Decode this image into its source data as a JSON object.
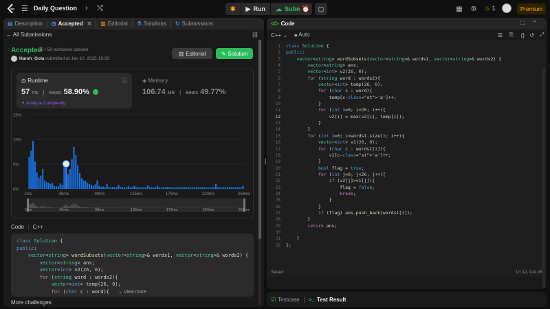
{
  "topbar": {
    "problem_title": "Daily Question",
    "run_label": "Run",
    "submit_label": "Submit",
    "streak": "1",
    "premium_label": "Premium"
  },
  "left_tabs": [
    {
      "label": "Description"
    },
    {
      "label": "Accepted"
    },
    {
      "label": "Editorial"
    },
    {
      "label": "Solutions"
    },
    {
      "label": "Submissions"
    }
  ],
  "submission": {
    "back_label": "All Submissions",
    "status": "Accepted",
    "passed": "56 / 56 testcases passed",
    "user": "Harsh_Gola",
    "submitted_text": "submitted at Jan 10, 2025 19:33",
    "editorial_button": "Editorial",
    "solution_button": "Solution"
  },
  "runtime": {
    "title": "Runtime",
    "value": "57",
    "unit": "ms",
    "beats_label": "Beats",
    "beats_pct": "58.90%",
    "analyze": "Analyze Complexity"
  },
  "memory": {
    "title": "Memory",
    "value": "106.74",
    "unit": "MB",
    "beats_label": "Beats",
    "beats_pct": "49.77%"
  },
  "chart_data": {
    "type": "bar",
    "ylabel": "",
    "ylim": [
      0,
      15
    ],
    "y_ticks": [
      "15%",
      "10%",
      "5%",
      "0%"
    ],
    "x_ticks": [
      "2ms",
      "46ms",
      "90ms",
      "135ms",
      "179ms",
      "224ms",
      "268ms"
    ],
    "x_range": [
      2,
      268
    ],
    "values": [
      6.5,
      7.7,
      9.7,
      5.5,
      3.3,
      2.2,
      2.7,
      4.0,
      1.7,
      1.4,
      1.2,
      1.0,
      1.2,
      0.6,
      0.5,
      0.5,
      1.1,
      0.8,
      4.5,
      5.6,
      3.0,
      4.0,
      6.0,
      8.5,
      6.8,
      4.8,
      3.2,
      2.2,
      1.7,
      1.6,
      1.2,
      1.0,
      0.8,
      0.6,
      0.9,
      1.7,
      0.6,
      0.4,
      0.5,
      0.3,
      1.0,
      0.4,
      0.3,
      0.4,
      0.3,
      0.3,
      0.8,
      0.4,
      0.3,
      0.3,
      0.3,
      0.6,
      0.3,
      0.3,
      0.6,
      0.3,
      0.3,
      0.3,
      0.3,
      0.3,
      0.3,
      0.7,
      0.3,
      0.3,
      0.3,
      0.3,
      0.6,
      0.3,
      0.3,
      0.3,
      0.3,
      0.4,
      0.3,
      0.3,
      0.3,
      0.3,
      0.3,
      0.3,
      0.3,
      0.3,
      0.3,
      0.3,
      0.3,
      0.3,
      0.3,
      0.3,
      0.3,
      0.3,
      0.3,
      0.3,
      0.3,
      0.3,
      0.3,
      0.3,
      0.3,
      0.3,
      1.0,
      0.3,
      0.3,
      0.3,
      0.3,
      0.3,
      0.3,
      0.4,
      0.3,
      0.3,
      0.3,
      0.3,
      0.3,
      0.3,
      0.6
    ],
    "highlight_index": 19,
    "mini_ticks": [
      "2ms",
      "46ms",
      "90ms",
      "135ms",
      "179ms",
      "224ms",
      "268ms"
    ]
  },
  "code_section": {
    "label": "Code",
    "language": "C++",
    "preview_lines": [
      "class Solution {",
      "public:",
      "    vector<string> wordSubsets(vector<string>& words1, vector<string>& words2) {",
      "        vector<string> ans;",
      "        vector<int> v2(26, 0);",
      "        for (string word : words2){",
      "            vector<int> temp(26, 0);",
      "            for (char c : word){"
    ],
    "view_more": "View more",
    "more_challenges": "More challenges"
  },
  "editor": {
    "panel_title": "Code",
    "language": "C++",
    "mode": "Auto",
    "saved": "Saved",
    "cursor": "Ln 12, Col 45",
    "current_line": 12,
    "lines": [
      "class Solution {",
      "public:",
      "    vector<string> wordSubsets(vector<string>& words1, vector<string>& words2) {",
      "        vector<string> ans;",
      "        vector<int> v2(26, 0);",
      "        for (string word : words2){",
      "            vector<int> temp(26, 0);",
      "            for (char c : word){",
      "                temp[c-'a']++;",
      "            }",
      "            for (int i=0; i<26; i++){",
      "                v2[i] = max(v2[i], temp[i]);",
      "            }",
      "        }",
      "        for (int i=0; i<words1.size(); i++){",
      "            vector<int> v1(26, 0);",
      "            for (char c : words1[i]){",
      "                v1[c-'a']++;",
      "            }",
      "            bool flag = true;",
      "            for (int j=0; j<26; j++){",
      "                if (v2[j]>v1[j]){",
      "                    flag = false;",
      "                    break;",
      "                }",
      "            }",
      "            if (flag) ans.push_back(words1[i]);",
      "        }",
      "        return ans;",
      "",
      "    }",
      "};"
    ]
  },
  "bottom_tabs": {
    "testcase": "Testcase",
    "test_result": "Test Result"
  },
  "colors": {
    "accent_green": "#2cbb5d",
    "bar_blue": "#1a73e8",
    "premium": "#ffa116"
  }
}
